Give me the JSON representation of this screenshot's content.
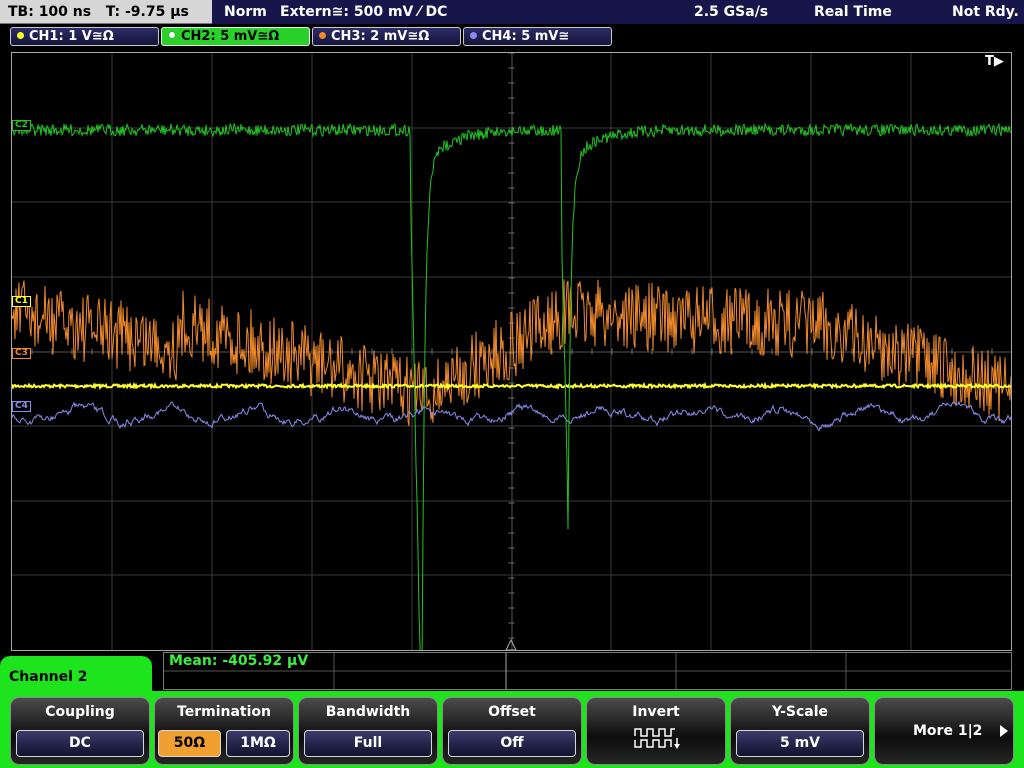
{
  "status_bar": {
    "timebase": "TB: 100 ns   T: -9.75 µs",
    "trigger_mode": "Norm",
    "trigger_source": "Extern≅: 500 mV ⁄ DC",
    "sample_rate": "2.5 GSa/s",
    "acquisition_mode": "Real Time",
    "status": "Not Rdy."
  },
  "channels": [
    {
      "label": "CH1: 1 V≅Ω",
      "color": "#ffff2a"
    },
    {
      "label": "CH2: 5 mV≅Ω",
      "color": "#22c522"
    },
    {
      "label": "CH3: 2 mV≅Ω",
      "color": "#f08a2a"
    },
    {
      "label": "CH4: 5 mV≅",
      "color": "#8a8aee"
    }
  ],
  "markers": {
    "trigger": "T▶",
    "ch1": "C1",
    "ch2": "C2",
    "ch3": "C3",
    "ch4": "C4"
  },
  "measurement": {
    "label": "Mean: -405.92 µV"
  },
  "menu": {
    "title": "Channel 2",
    "coupling": {
      "title": "Coupling",
      "value": "DC"
    },
    "termination": {
      "title": "Termination",
      "options": [
        "50Ω",
        "1MΩ"
      ],
      "selected": "50Ω"
    },
    "bandwidth": {
      "title": "Bandwidth",
      "value": "Full"
    },
    "offset": {
      "title": "Offset",
      "value": "Off"
    },
    "invert": {
      "title": "Invert",
      "icon": "invert-waveform-icon"
    },
    "yscale": {
      "title": "Y-Scale",
      "value": "5 mV"
    },
    "more": {
      "label": "More 1|2",
      "icon": "play-right-icon"
    }
  }
}
